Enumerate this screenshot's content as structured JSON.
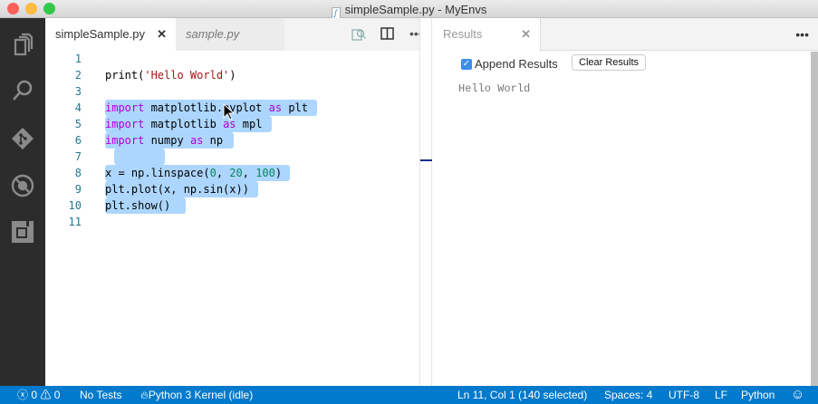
{
  "window": {
    "title": "simpleSample.py - MyEnvs",
    "colors": {
      "close": "#fc605b",
      "minimize": "#fdbc40",
      "zoom": "#34c84a"
    }
  },
  "activity_bar": [
    "files-icon",
    "search-icon",
    "git-icon",
    "debug-icon",
    "extensions-icon"
  ],
  "tabs": [
    {
      "label": "simpleSample.py",
      "active": true,
      "close": "✕"
    },
    {
      "label": "sample.py",
      "active": false
    }
  ],
  "editor_actions": {
    "more": "•••"
  },
  "editor": {
    "lines": [
      {
        "n": "1",
        "html": ""
      },
      {
        "n": "2",
        "html": "print(<span class='str'>'Hello World'</span>)"
      },
      {
        "n": "3",
        "html": ""
      },
      {
        "n": "4",
        "html": "<span class='kw'>import</span> matplotlib.pyplot <span class='kw'>as</span> plt"
      },
      {
        "n": "5",
        "html": "<span class='kw'>import</span> matplotlib <span class='kw'>as</span> mpl"
      },
      {
        "n": "6",
        "html": "<span class='kw'>import</span> numpy <span class='kw'>as</span> np"
      },
      {
        "n": "7",
        "html": ""
      },
      {
        "n": "8",
        "html": "x = np.linspace(<span class='num'>0</span>, <span class='num'>20</span>, <span class='num'>100</span>)"
      },
      {
        "n": "9",
        "html": "plt.plot(x, np.sin(x))"
      },
      {
        "n": "10",
        "html": "plt.show()"
      },
      {
        "n": "11",
        "html": ""
      }
    ]
  },
  "results": {
    "tab_label": "Results",
    "close": "✕",
    "more": "•••",
    "append_label": "Append Results",
    "append_checked": true,
    "clear_label": "Clear Results",
    "output": "Hello World"
  },
  "status": {
    "errors": "0",
    "warnings": "0",
    "tests": "No Tests",
    "kernel": "Python 3 Kernel (idle)",
    "position": "Ln 11, Col 1 (140 selected)",
    "spaces": "Spaces: 4",
    "encoding": "UTF-8",
    "eol": "LF",
    "language": "Python"
  }
}
